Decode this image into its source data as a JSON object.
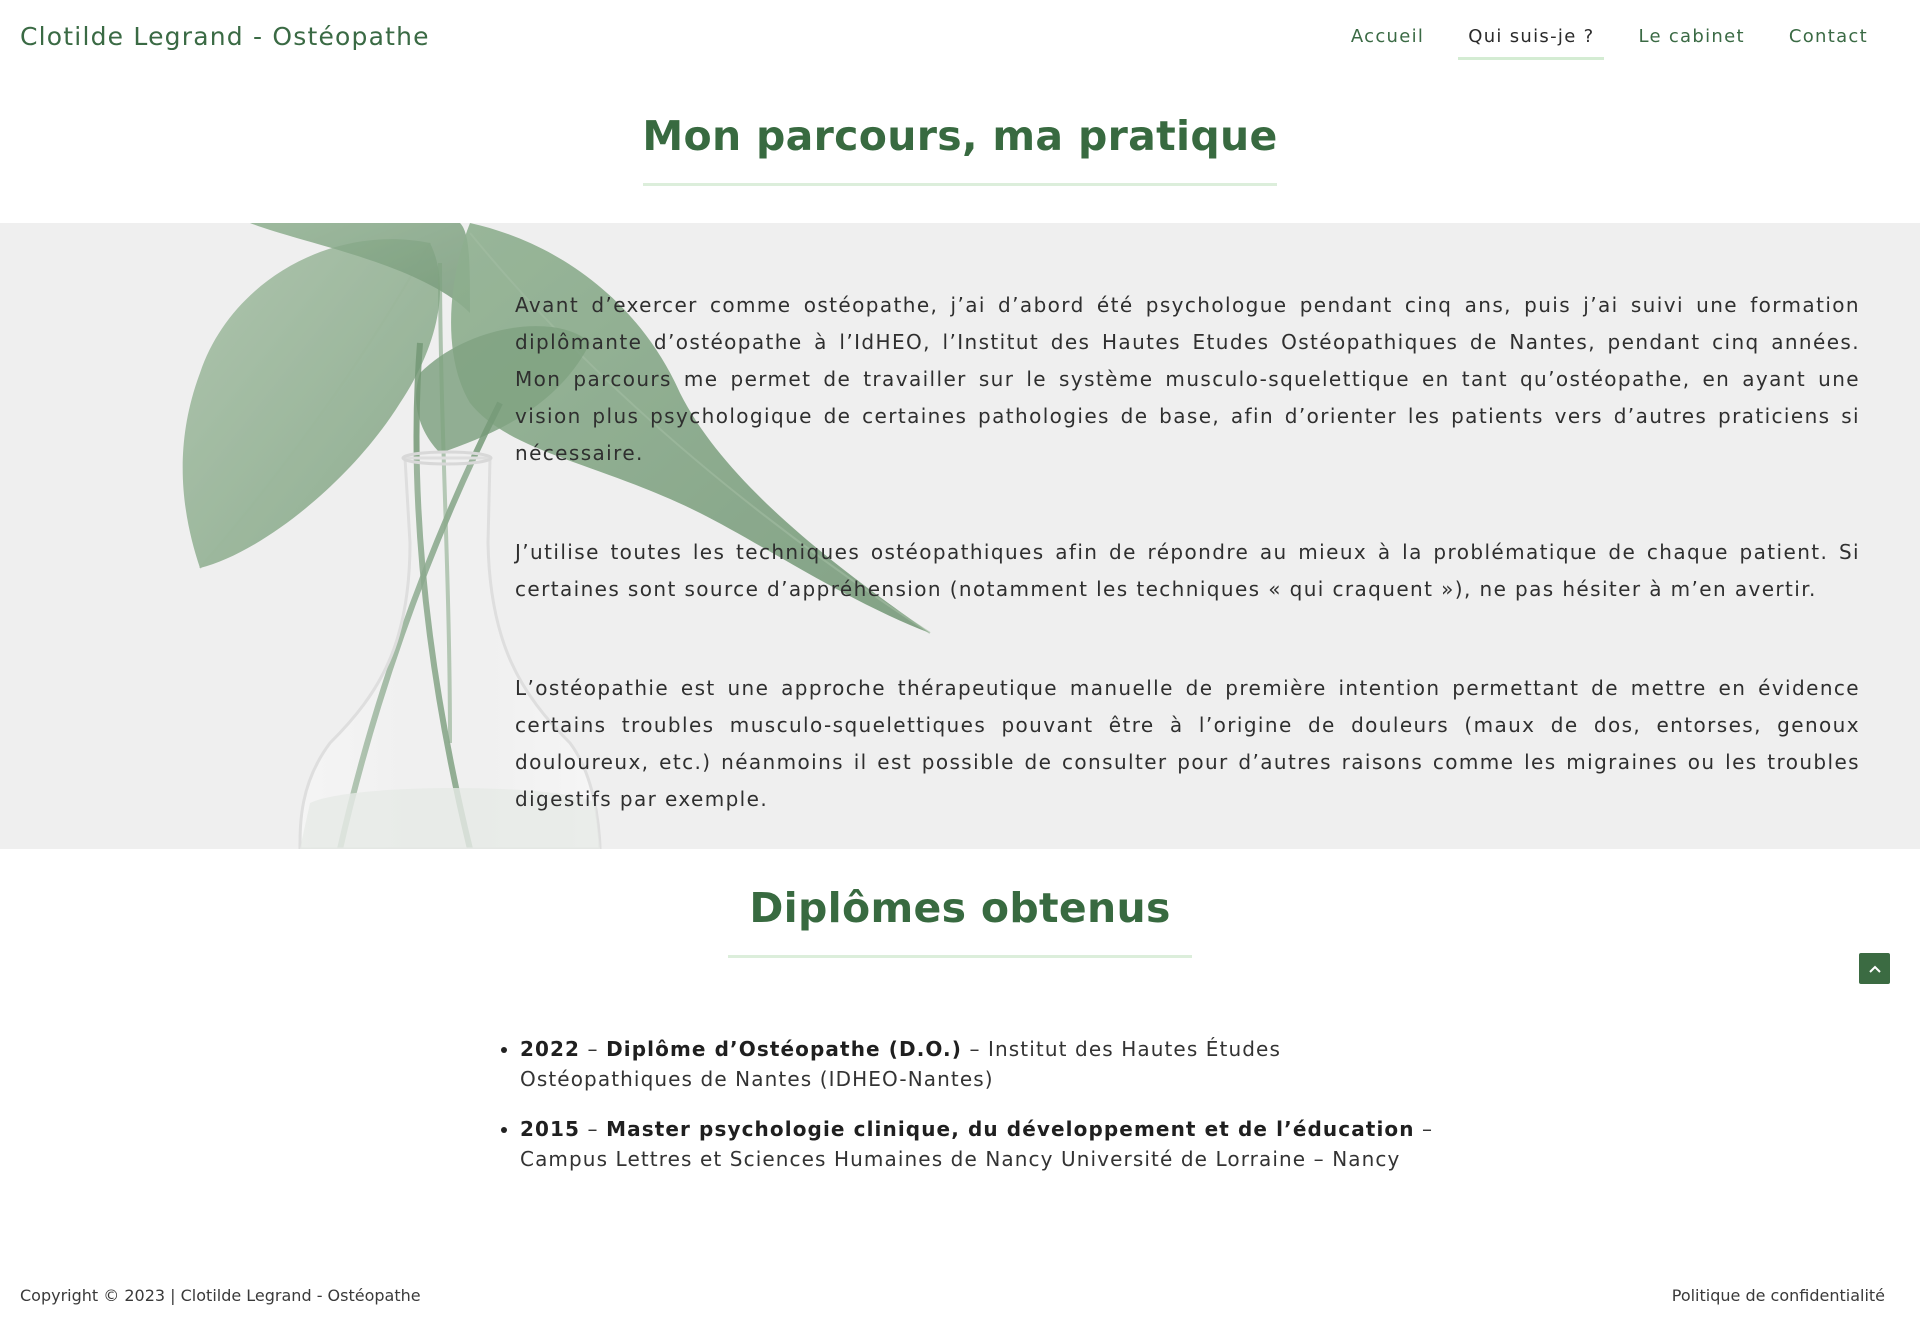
{
  "header": {
    "site_title": "Clotilde Legrand - Ostéopathe",
    "nav": [
      "Accueil",
      "Qui suis-je ?",
      "Le cabinet",
      "Contact"
    ],
    "current_nav": "Qui suis-je ?"
  },
  "parcours": {
    "title": "Mon parcours, ma pratique",
    "paragraphs": [
      "Avant d’exercer comme ostéopathe, j’ai d’abord été psychologue pendant cinq ans, puis j’ai suivi une formation diplômante d’ostéopathe à l’IdHEO, l’Institut des Hautes Etudes Ostéopathiques de Nantes, pendant cinq années. Mon parcours me permet de travailler sur le système musculo-squelettique en tant qu’ostéopathe, en ayant une vision plus psychologique de certaines pathologies de base, afin d’orienter les patients vers d’autres praticiens si nécessaire.",
      "J’utilise toutes les techniques ostéopathiques afin de répondre au mieux à la problématique de chaque patient. Si certaines sont source d’appréhension (notamment les techniques « qui craquent »), ne pas hésiter à m’en avertir.",
      "L’ostéopathie est une approche thérapeutique manuelle de première intention permettant de mettre en évidence certains troubles musculo-squelettiques pouvant être à l’origine de douleurs (maux de dos, entorses, genoux douloureux, etc.) néanmoins il est possible de consulter pour d’autres raisons comme les migraines ou les troubles digestifs par exemple."
    ]
  },
  "diplomes": {
    "title": "Diplômes obtenus",
    "items": [
      {
        "year": "2022",
        "sep1": " – ",
        "degree": "Diplôme d’Ostéopathe (D.O.)",
        "sep2": " – ",
        "school": "Institut des Hautes Études Ostéopathiques de Nantes (IDHEO-Nantes)"
      },
      {
        "year": "2015",
        "sep1": " – ",
        "degree": "Master psychologie clinique, du développement et de l’éducation",
        "sep2": " – ",
        "school": "Campus Lettres et Sciences Humaines de Nancy Université de Lorraine – Nancy"
      }
    ]
  },
  "scroll_top_icon": "chevron-up-icon",
  "footer": {
    "copyright": "Copyright © 2023 | Clotilde Legrand - Ostéopathe",
    "privacy": "Politique de confidentialité"
  },
  "colors": {
    "brand_green": "#386a40",
    "underline_green": "#dceedb",
    "band_background": "#efefef"
  }
}
